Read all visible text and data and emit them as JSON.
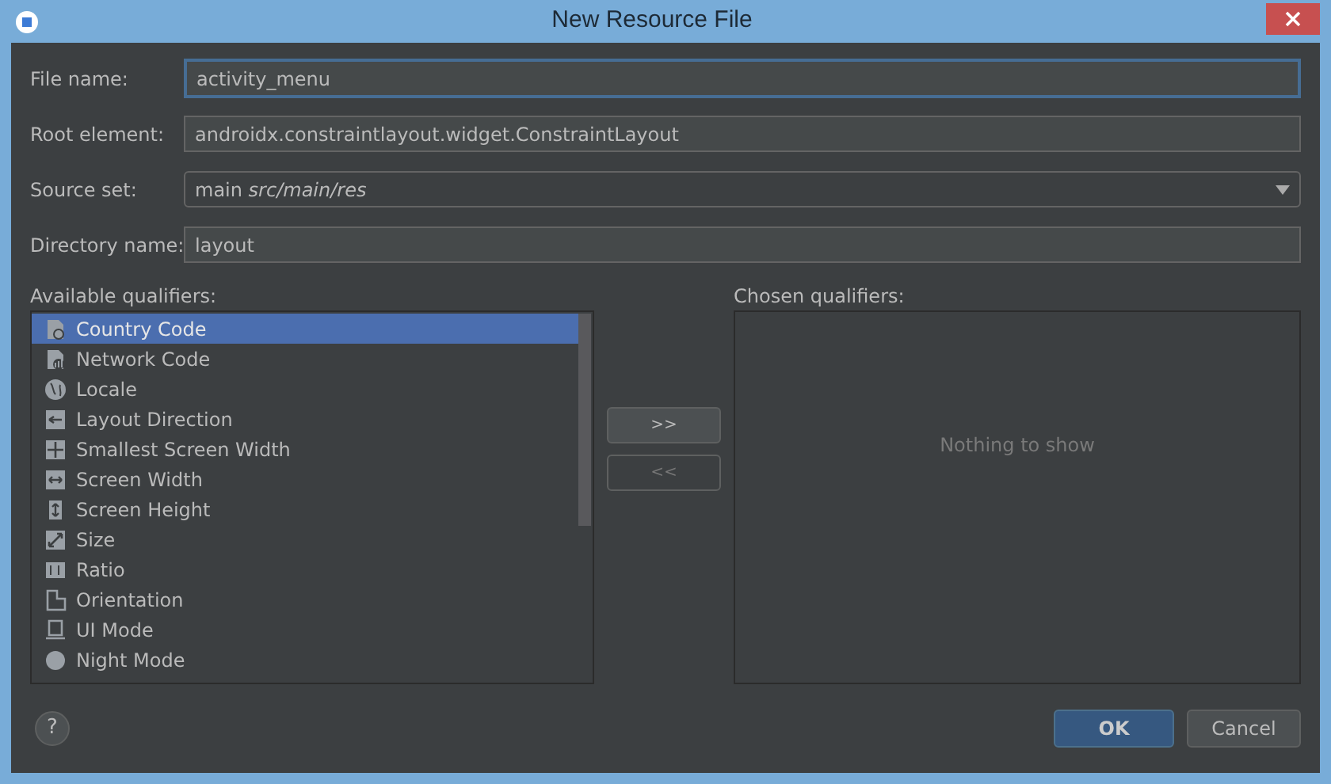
{
  "window": {
    "title": "New Resource File"
  },
  "fields": [
    {
      "label": "File name:",
      "kind": "text",
      "value": "activity_menu",
      "focused": true
    },
    {
      "label": "Root element:",
      "kind": "text",
      "value": "androidx.constraintlayout.widget.ConstraintLayout",
      "focused": false
    },
    {
      "label": "Source set:",
      "kind": "dropdown",
      "value": "main *src/main/res*",
      "focused": false
    },
    {
      "label": "Directory name:",
      "kind": "text",
      "value": "layout",
      "focused": false
    }
  ],
  "available_qualifiers": {
    "label": "Available qualifiers:",
    "items": [
      {
        "label": "Country Code",
        "selected": true
      },
      {
        "label": "Network Code",
        "selected": false
      },
      {
        "label": "Locale",
        "selected": false
      },
      {
        "label": "Layout Direction",
        "selected": false
      },
      {
        "label": "Smallest Screen Width",
        "selected": false
      },
      {
        "label": "Screen Width",
        "selected": false
      },
      {
        "label": "Screen Height",
        "selected": false
      },
      {
        "label": "Size",
        "selected": false
      },
      {
        "label": "Ratio",
        "selected": false
      },
      {
        "label": "Orientation",
        "selected": false
      },
      {
        "label": "UI Mode",
        "selected": false
      },
      {
        "label": "Night Mode",
        "selected": false
      }
    ]
  },
  "transfer_buttons": [
    {
      "label": ">>",
      "disabled": false
    },
    {
      "label": "<<",
      "disabled": true
    }
  ],
  "chosen_qualifiers": {
    "label": "Chosen qualifiers:",
    "empty_text": "Nothing to show"
  },
  "help": {
    "label": "?"
  },
  "buttons": [
    {
      "label": "OK",
      "default": true
    },
    {
      "label": "Cancel",
      "default": false
    }
  ]
}
